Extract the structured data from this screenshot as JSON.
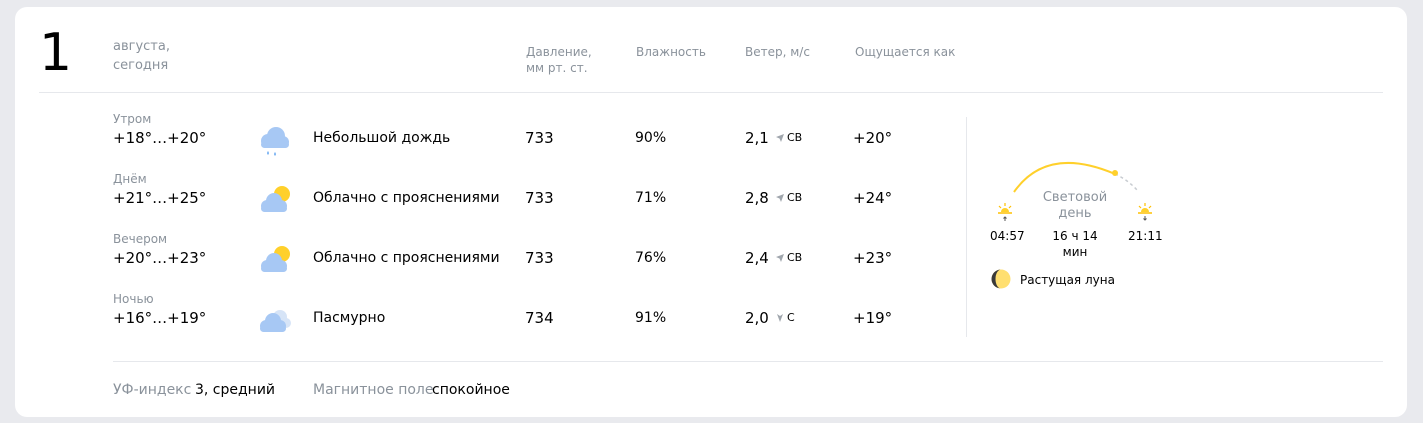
{
  "header": {
    "day_number": "1",
    "date_line1": "августа,",
    "date_line2": "сегодня",
    "col_pressure_line1": "Давление,",
    "col_pressure_line2": "мм рт. ст.",
    "col_humidity": "Влажность",
    "col_wind": "Ветер, м/с",
    "col_feels": "Ощущается как"
  },
  "rows": [
    {
      "part": "Утром",
      "temp": "+18°…+20°",
      "icon": "light-rain-icon",
      "condition": "Небольшой дождь",
      "pressure": "733",
      "humidity": "90%",
      "wind_speed": "2,1",
      "wind_dir": "СВ",
      "feels": "+20°"
    },
    {
      "part": "Днём",
      "temp": "+21°…+25°",
      "icon": "partly-cloudy-icon",
      "condition": "Облачно с прояснениями",
      "pressure": "733",
      "humidity": "71%",
      "wind_speed": "2,8",
      "wind_dir": "СВ",
      "feels": "+24°"
    },
    {
      "part": "Вечером",
      "temp": "+20°…+23°",
      "icon": "partly-cloudy-icon",
      "condition": "Облачно с прояснениями",
      "pressure": "733",
      "humidity": "76%",
      "wind_speed": "2,4",
      "wind_dir": "СВ",
      "feels": "+23°"
    },
    {
      "part": "Ночью",
      "temp": "+16°…+19°",
      "icon": "overcast-icon",
      "condition": "Пасмурно",
      "pressure": "734",
      "humidity": "91%",
      "wind_speed": "2,0",
      "wind_dir": "С",
      "feels": "+19°"
    }
  ],
  "sun": {
    "sunrise": "04:57",
    "sunset": "21:11",
    "daylight_line1": "Световой",
    "daylight_line2": "день",
    "daylight_duration": "16 ч 14 мин",
    "sunrise_icon": "sunrise-icon",
    "sunset_icon": "sunset-icon"
  },
  "moon": {
    "phase": "Растущая луна",
    "icon": "waxing-moon-icon"
  },
  "footer": {
    "uv_label": "УФ-индекс",
    "uv_value": "3, средний",
    "magnetic_label": "Магнитное поле",
    "magnetic_value": "спокойное"
  },
  "colors": {
    "background": "#e9eaee",
    "card": "#ffffff",
    "secondary_text": "#8a929b",
    "sun_yellow": "#ffd02b",
    "cloud_blue": "#a7c8f4",
    "rain_blue": "#5fa3f0"
  }
}
